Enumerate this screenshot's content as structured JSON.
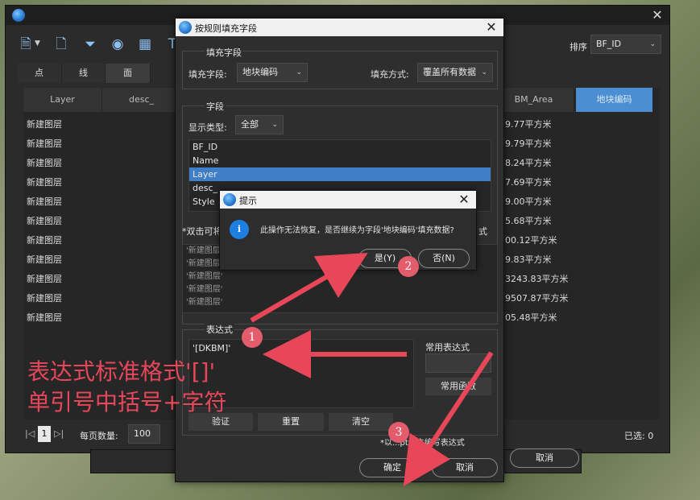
{
  "main": {
    "toolbar_icons": [
      "add-layer-icon",
      "document-search-icon",
      "filter-icon",
      "eye-icon",
      "calculator-icon",
      "text-icon"
    ],
    "tabs": [
      {
        "label": "点"
      },
      {
        "label": "线"
      },
      {
        "label": "面"
      }
    ],
    "sort_label": "排序",
    "sort_value": "BF_ID",
    "columns": [
      "Layer",
      "desc_",
      "BM_Area",
      "地块编码"
    ],
    "rows": [
      {
        "layer": "新建图层",
        "area": "9.77平方米"
      },
      {
        "layer": "新建图层",
        "area": "9.79平方米"
      },
      {
        "layer": "新建图层",
        "area": "8.24平方米"
      },
      {
        "layer": "新建图层",
        "area": "7.69平方米"
      },
      {
        "layer": "新建图层",
        "area": "9.00平方米"
      },
      {
        "layer": "新建图层",
        "area": "5.68平方米"
      },
      {
        "layer": "新建图层",
        "area": "00.12平方米"
      },
      {
        "layer": "新建图层",
        "area": "9.83平方米"
      },
      {
        "layer": "新建图层",
        "area": "3243.83平方米"
      },
      {
        "layer": "新建图层",
        "area": "9507.87平方米"
      },
      {
        "layer": "新建图层",
        "area": "05.48平方米"
      }
    ],
    "pager": {
      "page": "1",
      "page_size_label": "每页数量:",
      "page_size": "100"
    },
    "selected": "已选: 0",
    "behind_cancel": "取消"
  },
  "dialog": {
    "title": "按规则填充字段",
    "fill_group": "填充字段",
    "fill_field_label": "填充字段:",
    "fill_field_value": "地块编码",
    "fill_mode_label": "填充方式:",
    "fill_mode_value": "覆盖所有数据",
    "field_group": "字段",
    "display_type_label": "显示类型:",
    "display_type_value": "全部",
    "fields": [
      "BF_ID",
      "Name",
      "Layer",
      "desc_",
      "Style"
    ],
    "hint_left": "*双击可将",
    "hint_right": "式",
    "preview": [
      "'新建图层'",
      "'新建图层'",
      "'新建图层'",
      "'新建图层'",
      "'新建图层'"
    ],
    "expr_group": "表达式",
    "expr_value": "'[DKBM]'",
    "common_expr_label": "常用表达式",
    "common_expr_button": "常用函数",
    "btn_verify": "验证",
    "btn_reset": "重置",
    "btn_clear": "清空",
    "script_hint": "*以...pt语言编写表达式",
    "ok": "确定",
    "cancel": "取消"
  },
  "prompt": {
    "title": "提示",
    "message": "此操作无法恢复，是否继续为字段'地块编码'填充数据?",
    "yes": "是(Y)",
    "no": "否(N)"
  },
  "annotations": {
    "line1": "表达式标准格式'[]'",
    "line2": "单引号中括号+字符",
    "badges": [
      "1",
      "2",
      "3"
    ],
    "color": "#e8475a"
  }
}
